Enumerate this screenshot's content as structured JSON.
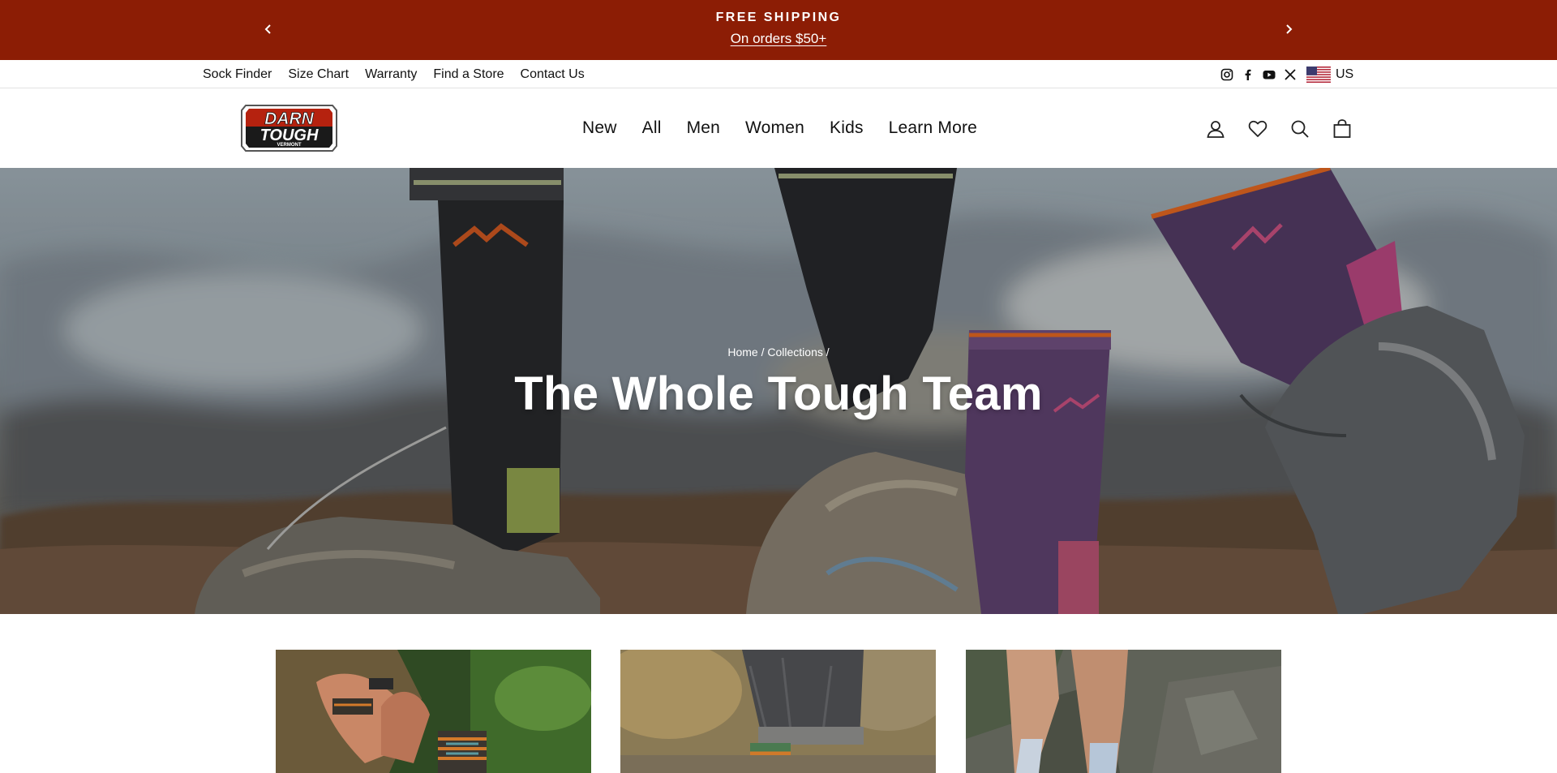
{
  "announcement": {
    "title": "FREE SHIPPING",
    "subtitle": "On orders $50+",
    "background_color": "#8c1d05",
    "prev_icon": "chevron-left-icon",
    "next_icon": "chevron-right-icon"
  },
  "utility_nav": {
    "links": [
      "Sock Finder",
      "Size Chart",
      "Warranty",
      "Find a Store",
      "Contact Us"
    ],
    "social_icons": [
      "instagram-icon",
      "facebook-icon",
      "youtube-icon",
      "x-icon"
    ],
    "country_flag": "us-flag-icon",
    "country": "US"
  },
  "header": {
    "logo": {
      "line1": "DARN",
      "line2": "TOUGH",
      "line3": "VERMONT",
      "brand_color": "#b5220f"
    },
    "nav": [
      "New",
      "All",
      "Men",
      "Women",
      "Kids",
      "Learn More"
    ],
    "icons": [
      "account-icon",
      "wishlist-heart-icon",
      "search-icon",
      "cart-bag-icon"
    ]
  },
  "hero": {
    "breadcrumb": [
      "Home",
      "Collections"
    ],
    "breadcrumb_separator": "/",
    "title": "The Whole Tough Team"
  },
  "collection_cards": [
    {
      "image": "hands-tying-hiking-boot-photo"
    },
    {
      "image": "jeans-cuff-with-patterned-sock-photo"
    },
    {
      "image": "legs-with-light-socks-on-rocks-photo"
    }
  ]
}
